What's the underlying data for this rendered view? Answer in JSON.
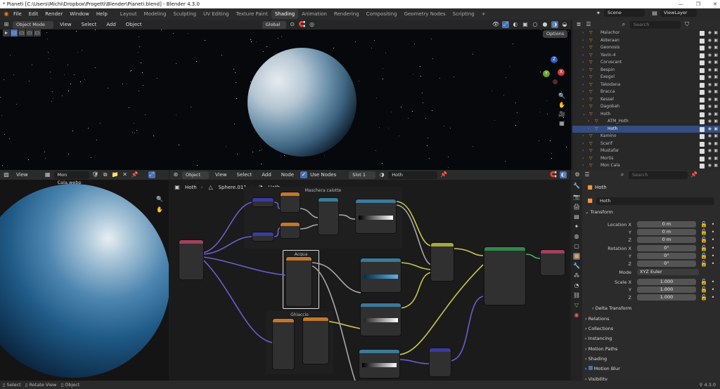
{
  "window": {
    "title": "* Pianeti [C:\\Users\\Michi\\Dropbox\\Progetti\\Blender\\Pianeti.blend] - Blender 4.3.0",
    "minimize": "—",
    "maximize": "❐",
    "close": "✕"
  },
  "menu": [
    "File",
    "Edit",
    "Render",
    "Window",
    "Help"
  ],
  "workspaces": [
    "Layout",
    "Modeling",
    "Sculpting",
    "UV Editing",
    "Texture Paint",
    "Shading",
    "Animation",
    "Rendering",
    "Compositing",
    "Geometry Nodes",
    "Scripting"
  ],
  "workspace_add": "+",
  "scene_label": "Scene",
  "viewlayer_label": "ViewLayer",
  "viewport": {
    "mode": "Object Mode",
    "menus": [
      "View",
      "Select",
      "Add",
      "Object"
    ],
    "transform": "Global",
    "options": "Options",
    "gizmo": {
      "x": "X",
      "y": "Y",
      "z": "Z"
    }
  },
  "outliner": {
    "search_placeholder": "Search",
    "items": [
      {
        "name": "Malachor",
        "sel": false
      },
      {
        "name": "Alderaan",
        "sel": false
      },
      {
        "name": "Geonosis",
        "sel": false
      },
      {
        "name": "Yavin-4",
        "sel": false
      },
      {
        "name": "Coruscant",
        "sel": false
      },
      {
        "name": "Bespin",
        "sel": false
      },
      {
        "name": "Exegol",
        "sel": false
      },
      {
        "name": "Takodana",
        "sel": false
      },
      {
        "name": "Bracca",
        "sel": false
      },
      {
        "name": "Kessel",
        "sel": false
      },
      {
        "name": "Dagobah",
        "sel": false
      },
      {
        "name": "Hoth",
        "sel": false
      },
      {
        "name": "ATM_Hoth",
        "sel": false
      },
      {
        "name": "Hoth",
        "sel": true
      },
      {
        "name": "Kamino",
        "sel": false
      },
      {
        "name": "Scarif",
        "sel": false
      },
      {
        "name": "Mustafar",
        "sel": false
      },
      {
        "name": "Mortis",
        "sel": false
      },
      {
        "name": "Mon Cala",
        "sel": false
      }
    ]
  },
  "image_editor": {
    "view": "View",
    "image_name": "Mon Cala.webp"
  },
  "node_editor": {
    "type": "Object",
    "menus": [
      "View",
      "Select",
      "Add",
      "Node"
    ],
    "use_nodes": "Use Nodes",
    "slot": "Slot 1",
    "material": "Hoth",
    "breadcrumb": [
      "Hoth",
      "Sphere.011",
      "Hoth"
    ],
    "frames": {
      "ice": "Maschera calotte",
      "water": "Acqua",
      "glacier": "Ghiaccio"
    }
  },
  "properties": {
    "search_placeholder": "Search",
    "object_name": "Hoth",
    "object_field": "Hoth",
    "transform_title": "Transform",
    "location_label": "Location X",
    "rotation_label": "Rotation X",
    "mode_label": "Mode",
    "scale_label": "Scale X",
    "axis_y": "Y",
    "axis_z": "Z",
    "location": [
      "0 m",
      "0 m",
      "0 m"
    ],
    "rotation": [
      "0°",
      "0°",
      "0°"
    ],
    "mode": "XYZ Euler",
    "scale": [
      "1.000",
      "1.000",
      "1.000"
    ],
    "delta_transform": "Delta Transform",
    "sections": [
      "Relations",
      "Collections",
      "Instancing",
      "Motion Paths",
      "Shading",
      "Motion Blur",
      "Visibility"
    ]
  },
  "status": {
    "select": "Select",
    "rotate_view": "Rotate View",
    "object": "Object",
    "version": "4.3.0"
  },
  "colors": {
    "selection": "#334d80",
    "accent": "#4772b3",
    "header": "#2b2b2b"
  }
}
